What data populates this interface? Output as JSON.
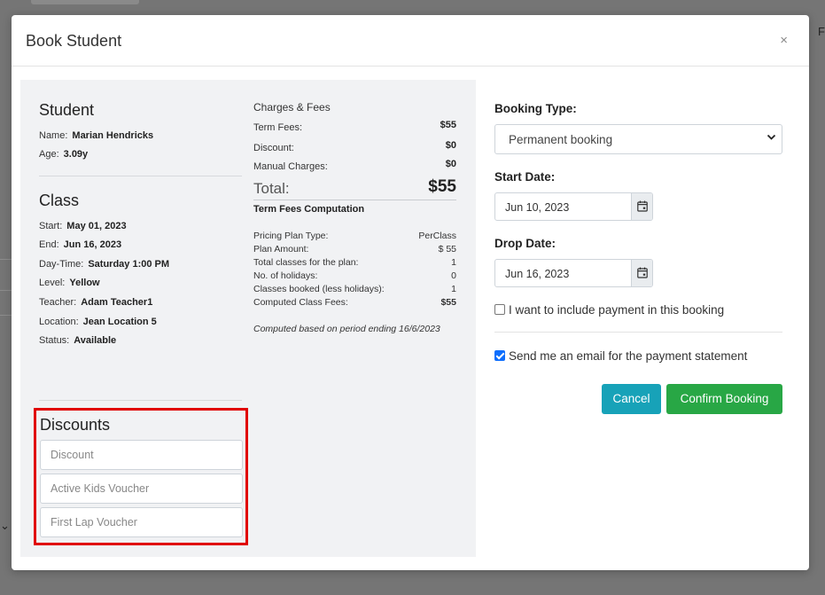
{
  "background": {
    "right_letter": "F"
  },
  "modal": {
    "title": "Book Student",
    "close_glyph": "×"
  },
  "student": {
    "heading": "Student",
    "name_label": "Name:",
    "name": "Marian Hendricks",
    "age_label": "Age:",
    "age": "3.09y"
  },
  "class_info": {
    "heading": "Class",
    "rows": [
      {
        "label": "Start:",
        "value": "May 01, 2023"
      },
      {
        "label": "End:",
        "value": "Jun 16, 2023"
      },
      {
        "label": "Day-Time:",
        "value": "Saturday 1:00 PM"
      },
      {
        "label": "Level:",
        "value": "Yellow"
      },
      {
        "label": "Teacher:",
        "value": "Adam Teacher1"
      },
      {
        "label": "Location:",
        "value": "Jean Location 5"
      },
      {
        "label": "Status:",
        "value": "Available"
      }
    ]
  },
  "fees": {
    "heading": "Charges & Fees",
    "term_label": "Term Fees:",
    "term": "$55",
    "discount_label": "Discount:",
    "discount": "$0",
    "manual_label": "Manual Charges:",
    "manual": "$0",
    "total_label": "Total:",
    "total": "$55",
    "computation_heading": "Term Fees Computation",
    "computation": [
      {
        "label": "Pricing Plan Type:",
        "value": "PerClass"
      },
      {
        "label": "Plan Amount:",
        "value": "$ 55"
      },
      {
        "label": "Total classes for the plan:",
        "value": "1"
      },
      {
        "label": "No. of holidays:",
        "value": "0"
      },
      {
        "label": "Classes booked (less holidays):",
        "value": "1"
      },
      {
        "label": "Computed Class Fees:",
        "value": "$55"
      }
    ],
    "note": "Computed based on period ending 16/6/2023"
  },
  "discounts": {
    "heading": "Discounts",
    "discount_placeholder": "Discount",
    "active_kids_placeholder": "Active Kids Voucher",
    "first_lap_placeholder": "First Lap Voucher"
  },
  "form": {
    "booking_type_label": "Booking Type:",
    "booking_type_value": "Permanent booking",
    "start_date_label": "Start Date:",
    "start_date_value": "Jun 10, 2023",
    "drop_date_label": "Drop Date:",
    "drop_date_value": "Jun 16, 2023",
    "include_payment_label": "I want to include payment in this booking",
    "include_payment_checked": false,
    "email_statement_label": "Send me an email for the payment statement",
    "email_statement_checked": true,
    "cancel_label": "Cancel",
    "confirm_label": "Confirm Booking"
  },
  "colors": {
    "cancel": "#17a2b8",
    "confirm": "#28a745",
    "highlight_border": "#e00000",
    "checkbox_checked": "#0d6efd"
  }
}
